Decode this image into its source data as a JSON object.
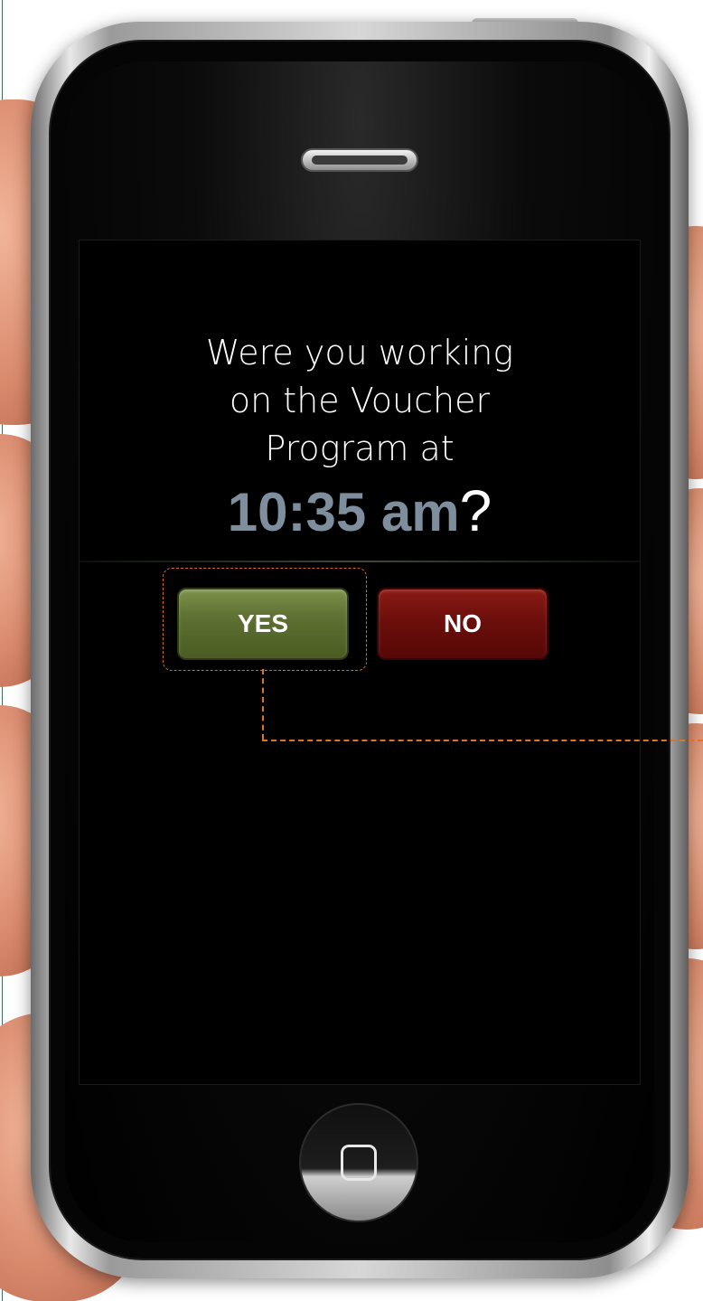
{
  "prompt": {
    "question_lines": [
      "Were you working",
      "on the Voucher",
      "Program at"
    ],
    "time": "10:35 am",
    "question_mark": "?"
  },
  "actions": {
    "yes_label": "YES",
    "no_label": "NO"
  },
  "colors": {
    "yes_button": "#5c6e30",
    "no_button": "#6c0f0c",
    "time_text": "#7e8e9d",
    "highlight_callout": "#e07420"
  },
  "icons": {
    "home": "home-button-icon",
    "speaker": "earpiece-speaker-icon"
  }
}
